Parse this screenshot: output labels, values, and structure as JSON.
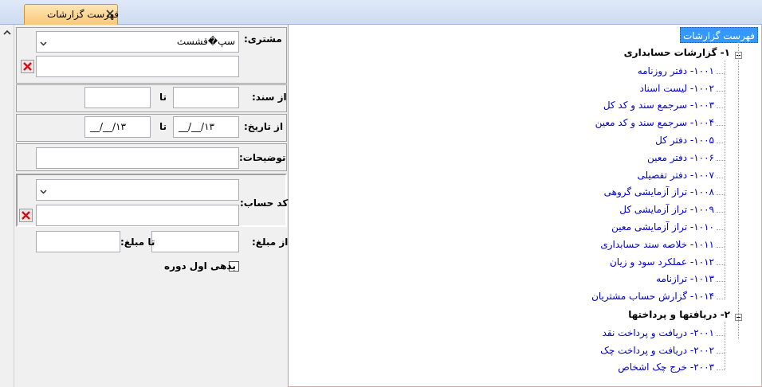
{
  "tab": {
    "title": "فهرست گزارشات"
  },
  "form": {
    "customer_label": "مشتری:",
    "customer_value": "سپ�قشسث",
    "doc_from_label": "از سند:",
    "to_label": "تا",
    "date_from_label": "از تاریخ:",
    "date_from_value": "__/__/۱۳",
    "date_to_value": "__/__/۱۳",
    "desc_label": "توضیحات:",
    "account_label": "کد حساب:",
    "amount_from_label": "از مبلغ:",
    "amount_to_label": "تا مبلغ:",
    "opening_debit_label": "بدهی اول دوره"
  },
  "tree": {
    "root": "فهرست گزارشات",
    "groups": [
      {
        "label": "۱- گزارشات حسابداری",
        "items": [
          "۱۰۰۱- دفتر روزنامه",
          "۱۰۰۲- لیست اسناد",
          "۱۰۰۳- سرجمع سند و کد کل",
          "۱۰۰۴- سرجمع سند و کد معین",
          "۱۰۰۵- دفتر کل",
          "۱۰۰۶- دفتر معین",
          "۱۰۰۷- دفتر تفصیلی",
          "۱۰۰۸- تراز آزمایشی گروهی",
          "۱۰۰۹- تراز آزمایشی کل",
          "۱۰۱۰- تراز آزمایشی معین",
          "۱۰۱۱- خلاصه سند حسابداری",
          "۱۰۱۲- عملکرد سود و زیان",
          "۱۰۱۳- ترازنامه",
          "۱۰۱۴- گزارش حساب مشتریان"
        ]
      },
      {
        "label": "۲- دریافتها و پرداختها",
        "items": [
          "۲۰۰۱- دریافت و پرداخت نقد",
          "۲۰۰۲- دریافت و پرداخت چک",
          "۲۰۰۳- خرج چک اشخاص"
        ]
      }
    ]
  }
}
